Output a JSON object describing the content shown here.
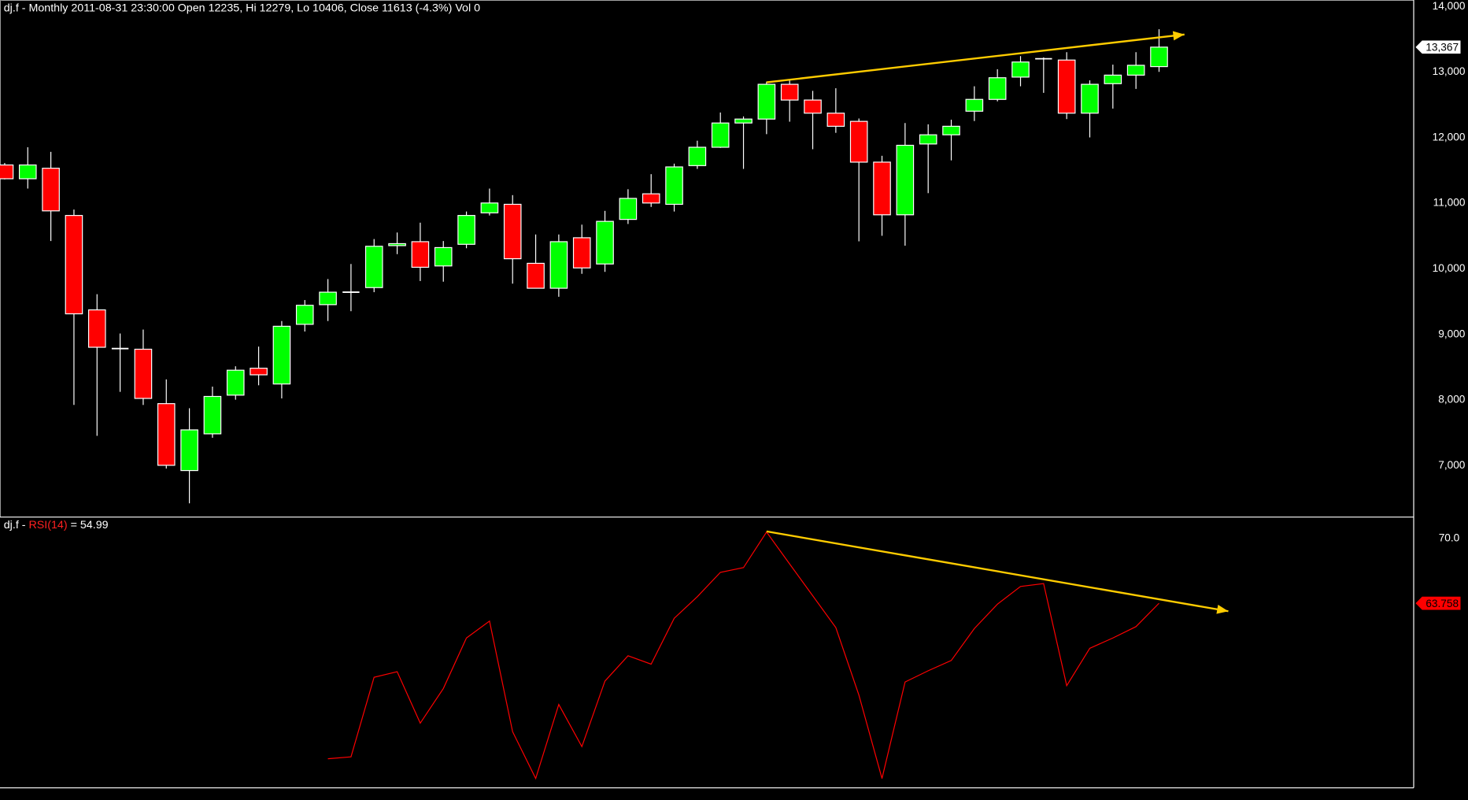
{
  "chart_data": [
    {
      "type": "candlestick",
      "title": "dj.f - Monthly 2011-08-31 23:30:00 Open 12235, Hi 12279, Lo 10406, Close 11613 (-4.3%) Vol 0",
      "ylim": [
        6400,
        14000
      ],
      "yticks": [
        "14,000",
        "13,000",
        "12,000",
        "11,000",
        "10,000",
        "9,000",
        "8,000",
        "7,000"
      ],
      "ytick_values": [
        14000,
        13000,
        12000,
        11000,
        10000,
        9000,
        8000,
        7000
      ],
      "last_value_label": "13,367",
      "last_value": 13367,
      "colors": {
        "up": "#00ff00",
        "down": "#ff0000",
        "outline": "#ffffff",
        "trend": "#ffcc00"
      },
      "ohlc": [
        [
          11570,
          11600,
          11350,
          11360
        ],
        [
          11360,
          11840,
          11210,
          11570
        ],
        [
          11520,
          11770,
          10410,
          10870
        ],
        [
          10800,
          10890,
          7910,
          9300
        ],
        [
          9360,
          9600,
          7440,
          8790
        ],
        [
          8770,
          9000,
          8110,
          8770
        ],
        [
          8760,
          9060,
          7910,
          8010
        ],
        [
          7930,
          8300,
          6940,
          6990
        ],
        [
          6910,
          7860,
          6410,
          7530
        ],
        [
          7470,
          8190,
          7410,
          8040
        ],
        [
          8060,
          8500,
          7990,
          8440
        ],
        [
          8470,
          8800,
          8210,
          8370
        ],
        [
          8230,
          9190,
          8010,
          9110
        ],
        [
          9140,
          9510,
          9030,
          9430
        ],
        [
          9440,
          9830,
          9190,
          9630
        ],
        [
          9630,
          10060,
          9340,
          9630
        ],
        [
          9700,
          10440,
          9630,
          10330
        ],
        [
          10340,
          10540,
          10210,
          10370
        ],
        [
          10400,
          10690,
          9800,
          10010
        ],
        [
          10030,
          10410,
          9790,
          10310
        ],
        [
          10360,
          10860,
          10300,
          10800
        ],
        [
          10840,
          11210,
          10800,
          10990
        ],
        [
          10970,
          11110,
          9760,
          10140
        ],
        [
          10070,
          10510,
          9690,
          9690
        ],
        [
          9690,
          10510,
          9560,
          10400
        ],
        [
          10460,
          10660,
          9910,
          10000
        ],
        [
          10060,
          10870,
          9940,
          10710
        ],
        [
          10740,
          11200,
          10670,
          11060
        ],
        [
          11130,
          11430,
          10930,
          10990
        ],
        [
          10970,
          11590,
          10860,
          11540
        ],
        [
          11560,
          11940,
          11510,
          11840
        ],
        [
          11840,
          12370,
          11830,
          12210
        ],
        [
          12210,
          12310,
          11510,
          12270
        ],
        [
          12270,
          12840,
          12040,
          12800
        ],
        [
          12800,
          12860,
          12230,
          12560
        ],
        [
          12560,
          12700,
          11810,
          12360
        ],
        [
          12360,
          12740,
          12060,
          12160
        ],
        [
          12235,
          12279,
          10406,
          11613
        ],
        [
          11613,
          11710,
          10490,
          10810
        ],
        [
          10810,
          12210,
          10340,
          11870
        ],
        [
          11890,
          12190,
          11140,
          12030
        ],
        [
          12030,
          12260,
          11640,
          12160
        ],
        [
          12390,
          12770,
          12240,
          12570
        ],
        [
          12570,
          13030,
          12540,
          12900
        ],
        [
          12910,
          13230,
          12770,
          13140
        ],
        [
          13190,
          13210,
          12670,
          13190
        ],
        [
          13170,
          13290,
          12270,
          12360
        ],
        [
          12360,
          12860,
          11990,
          12800
        ],
        [
          12810,
          13100,
          12430,
          12940
        ],
        [
          12940,
          13290,
          12730,
          13090
        ],
        [
          13070,
          13640,
          12990,
          13367
        ]
      ],
      "trendline": {
        "from": [
          33,
          12830
        ],
        "to": [
          51.1,
          13560
        ]
      }
    },
    {
      "type": "line",
      "title_prefix": "dj.f - ",
      "indicator": "RSI(14)",
      "title_suffix": " = 54.99",
      "ylim": [
        45,
        72
      ],
      "yticks": [
        "70.0"
      ],
      "ytick_values": [
        70
      ],
      "last_value_label": "63.758",
      "last_value": 63.758,
      "start_index": 14,
      "values": [
        48.95,
        49.13,
        56.71,
        57.24,
        52.34,
        55.64,
        60.45,
        62.06,
        51.53,
        47.07,
        54.12,
        50.11,
        56.35,
        58.76,
        57.96,
        62.33,
        64.38,
        66.7,
        67.15,
        70.54,
        67.5,
        64.47,
        61.44,
        55.01,
        47.07,
        56.26,
        57.33,
        58.31,
        61.35,
        63.67,
        65.36,
        65.63,
        55.91,
        59.47,
        60.45,
        61.53,
        63.758
      ],
      "colors": {
        "line": "#ff0000",
        "trend": "#ffcc00",
        "indicator_label": "#ff2020"
      },
      "trendline": {
        "from": [
          33,
          70.6
        ],
        "to": [
          53,
          63.0
        ]
      }
    }
  ]
}
